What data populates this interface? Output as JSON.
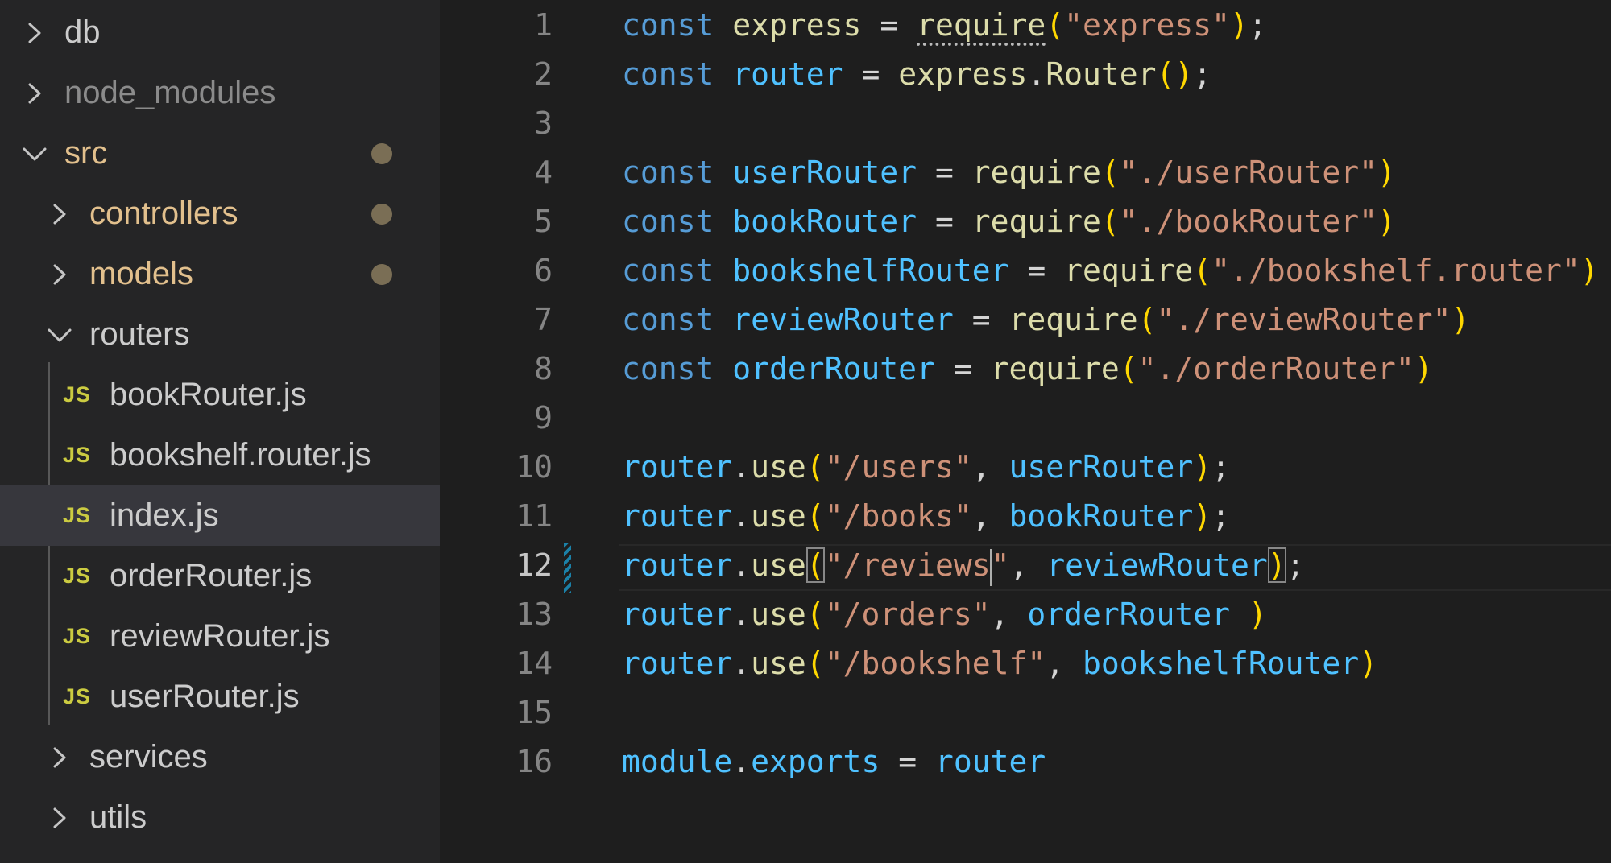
{
  "explorer": {
    "items": [
      {
        "label": "db",
        "type": "folder",
        "expanded": false,
        "style": "normal"
      },
      {
        "label": "node_modules",
        "type": "folder",
        "expanded": false,
        "style": "dim"
      },
      {
        "label": "src",
        "type": "folder",
        "expanded": true,
        "style": "modified"
      },
      {
        "label": "controllers",
        "type": "folder",
        "expanded": false,
        "style": "modified"
      },
      {
        "label": "models",
        "type": "folder",
        "expanded": false,
        "style": "modified"
      },
      {
        "label": "routers",
        "type": "folder",
        "expanded": true,
        "style": "normal"
      },
      {
        "label": "bookRouter.js",
        "type": "file",
        "icon": "JS"
      },
      {
        "label": "bookshelf.router.js",
        "type": "file",
        "icon": "JS"
      },
      {
        "label": "index.js",
        "type": "file",
        "icon": "JS",
        "selected": true
      },
      {
        "label": "orderRouter.js",
        "type": "file",
        "icon": "JS"
      },
      {
        "label": "reviewRouter.js",
        "type": "file",
        "icon": "JS"
      },
      {
        "label": "userRouter.js",
        "type": "file",
        "icon": "JS"
      },
      {
        "label": "services",
        "type": "folder",
        "expanded": false,
        "style": "normal"
      },
      {
        "label": "utils",
        "type": "folder",
        "expanded": false,
        "style": "normal"
      }
    ]
  },
  "editor": {
    "active_line": 12,
    "line_numbers": [
      "1",
      "2",
      "3",
      "4",
      "5",
      "6",
      "7",
      "8",
      "9",
      "10",
      "11",
      "12",
      "13",
      "14",
      "15",
      "16"
    ],
    "lines": [
      {
        "t1": "const",
        "t2": " ",
        "t3": "express",
        "t4": " = ",
        "t5": "require",
        "t6": "(",
        "t7": "\"express\"",
        "t8": ")",
        "t9": ";"
      },
      {
        "t1": "const",
        "t2": " ",
        "t3": "router",
        "t4": " = ",
        "t5": "express",
        "t6": ".",
        "t7": "Router",
        "t8": "()",
        "t9": ";"
      },
      {},
      {
        "t1": "const",
        "t2": " ",
        "t3": "userRouter",
        "t4": " = ",
        "t5": "require",
        "t6": "(",
        "t7": "\"./userRouter\"",
        "t8": ")"
      },
      {
        "t1": "const",
        "t2": " ",
        "t3": "bookRouter",
        "t4": " = ",
        "t5": "require",
        "t6": "(",
        "t7": "\"./bookRouter\"",
        "t8": ")"
      },
      {
        "t1": "const",
        "t2": " ",
        "t3": "bookshelfRouter",
        "t4": " = ",
        "t5": "require",
        "t6": "(",
        "t7": "\"./bookshelf.router\"",
        "t8": ")"
      },
      {
        "t1": "const",
        "t2": " ",
        "t3": "reviewRouter",
        "t4": " = ",
        "t5": "require",
        "t6": "(",
        "t7": "\"./reviewRouter\"",
        "t8": ")"
      },
      {
        "t1": "const",
        "t2": " ",
        "t3": "orderRouter",
        "t4": " = ",
        "t5": "require",
        "t6": "(",
        "t7": "\"./orderRouter\"",
        "t8": ")"
      },
      {},
      {
        "t1": "router",
        "t2": ".",
        "t3": "use",
        "t4": "(",
        "t5": "\"/users\"",
        "t6": ", ",
        "t7": "userRouter",
        "t8": ")",
        "t9": ";"
      },
      {
        "t1": "router",
        "t2": ".",
        "t3": "use",
        "t4": "(",
        "t5": "\"/books\"",
        "t6": ", ",
        "t7": "bookRouter",
        "t8": ")",
        "t9": ";"
      },
      {
        "t1": "router",
        "t2": ".",
        "t3": "use",
        "t4": "(",
        "t5a": "\"/reviews",
        "t5b": "\"",
        "t6": ", ",
        "t7": "reviewRouter",
        "t8": ")",
        "t9": ";"
      },
      {
        "t1": "router",
        "t2": ".",
        "t3": "use",
        "t4": "(",
        "t5": "\"/orders\"",
        "t6": ", ",
        "t7": "orderRouter",
        "t7b": " ",
        "t8": ")"
      },
      {
        "t1": "router",
        "t2": ".",
        "t3": "use",
        "t4": "(",
        "t5": "\"/bookshelf\"",
        "t6": ", ",
        "t7": "bookshelfRouter",
        "t8": ")"
      },
      {},
      {
        "t1": "module",
        "t2": ".",
        "t3": "exports",
        "t4": " = ",
        "t5": "router"
      }
    ]
  },
  "colors": {
    "sidebar_bg": "#252526",
    "editor_bg": "#1e1e1e",
    "selected_row": "#37373d",
    "modified_text": "#e2c08d",
    "modified_dot": "#7a6e55",
    "js_icon": "#cbcb41",
    "keyword": "#569cd6",
    "variable": "#4fc1ff",
    "function": "#dcdcaa",
    "string": "#ce9178",
    "bracket": "#ffd700",
    "dirty_gutter": "#1b81a8"
  },
  "icons": {
    "collapsed": "chevron-right-icon",
    "expanded": "chevron-down-icon",
    "file": "javascript-file-icon"
  }
}
